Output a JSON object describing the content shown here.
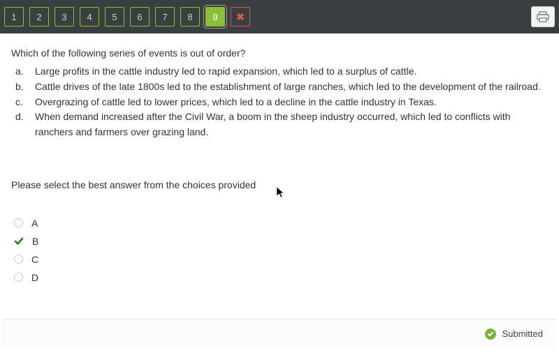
{
  "nav": {
    "items": [
      "1",
      "2",
      "3",
      "4",
      "5",
      "6",
      "7",
      "8",
      "9"
    ],
    "active_index": 8
  },
  "question": {
    "stem": "Which of the following series of events is out of order?",
    "options": [
      {
        "letter": "a.",
        "text": "Large profits in the cattle industry led to rapid expansion, which led to a surplus of cattle."
      },
      {
        "letter": "b.",
        "text": "Cattle drives of the late 1800s led to the establishment of large ranches, which led to the development of the railroad."
      },
      {
        "letter": "c.",
        "text": "Overgrazing of cattle led to lower prices, which led to a decline in the cattle industry in Texas."
      },
      {
        "letter": "d.",
        "text": "When demand increased after the Civil War, a boom in the sheep industry occurred, which led to conflicts with ranchers and farmers over grazing land."
      }
    ],
    "instruction": "Please select the best answer from the choices provided",
    "choices": [
      {
        "label": "A",
        "selected": false
      },
      {
        "label": "B",
        "selected": true
      },
      {
        "label": "C",
        "selected": false
      },
      {
        "label": "D",
        "selected": false
      }
    ]
  },
  "footer": {
    "status": "Submitted"
  }
}
